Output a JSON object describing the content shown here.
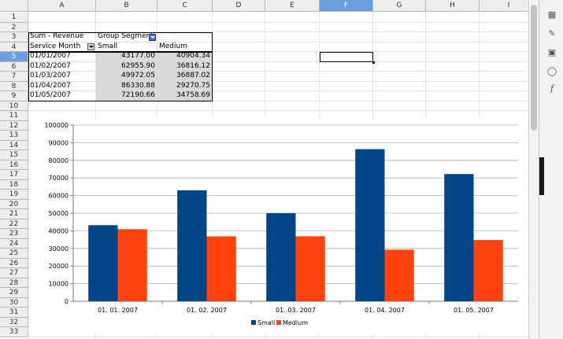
{
  "columns": [
    {
      "label": "A",
      "selected": false
    },
    {
      "label": "B",
      "selected": false
    },
    {
      "label": "C",
      "selected": false
    },
    {
      "label": "D",
      "selected": false
    },
    {
      "label": "E",
      "selected": false
    },
    {
      "label": "F",
      "selected": true
    },
    {
      "label": "G",
      "selected": false
    },
    {
      "label": "H",
      "selected": false
    },
    {
      "label": "I",
      "selected": false
    }
  ],
  "rows": [
    "1",
    "2",
    "3",
    "4",
    "5",
    "6",
    "7",
    "8",
    "9",
    "10",
    "11",
    "12",
    "13",
    "14",
    "15",
    "16",
    "17",
    "18",
    "19",
    "20",
    "21",
    "22",
    "23",
    "24",
    "25",
    "26",
    "27",
    "28",
    "29",
    "30",
    "31",
    "32",
    "33"
  ],
  "selected_row": "5",
  "pivot": {
    "data_field": "Sum - Revenue",
    "column_field": "Group Segment",
    "row_field": "Service Month",
    "col_headers": [
      "Small",
      "Medium"
    ],
    "rows": [
      {
        "month": "01/01/2007",
        "small": "43177.00",
        "medium": "40904.34"
      },
      {
        "month": "01/02/2007",
        "small": "62955.90",
        "medium": "36816.12"
      },
      {
        "month": "01/03/2007",
        "small": "49972.05",
        "medium": "36887.02"
      },
      {
        "month": "01/04/2007",
        "small": "86330.88",
        "medium": "29270.75"
      },
      {
        "month": "01/05/2007",
        "small": "72190.66",
        "medium": "34758.69"
      }
    ]
  },
  "chart_data": {
    "type": "bar",
    "categories": [
      "01. 01. 2007",
      "01. 02. 2007",
      "01. 03. 2007",
      "01. 04. 2007",
      "01. 05. 2007"
    ],
    "series": [
      {
        "name": "Small",
        "color": "#004586",
        "values": [
          43177.0,
          62955.9,
          49972.05,
          86330.88,
          72190.66
        ]
      },
      {
        "name": "Medium",
        "color": "#ff420e",
        "values": [
          40904.34,
          36816.12,
          36887.02,
          29270.75,
          34758.69
        ]
      }
    ],
    "yticks": [
      "0",
      "10000",
      "20000",
      "30000",
      "40000",
      "50000",
      "60000",
      "70000",
      "80000",
      "90000",
      "100000"
    ],
    "ylim": [
      0,
      100000
    ],
    "grid": true,
    "legend": "bottom",
    "title": "",
    "xlabel": "",
    "ylabel": ""
  },
  "sidebar": {
    "icons": [
      "properties-icon",
      "styles-icon",
      "gallery-icon",
      "navigator-icon",
      "functions-icon"
    ],
    "functions_label": "f"
  }
}
